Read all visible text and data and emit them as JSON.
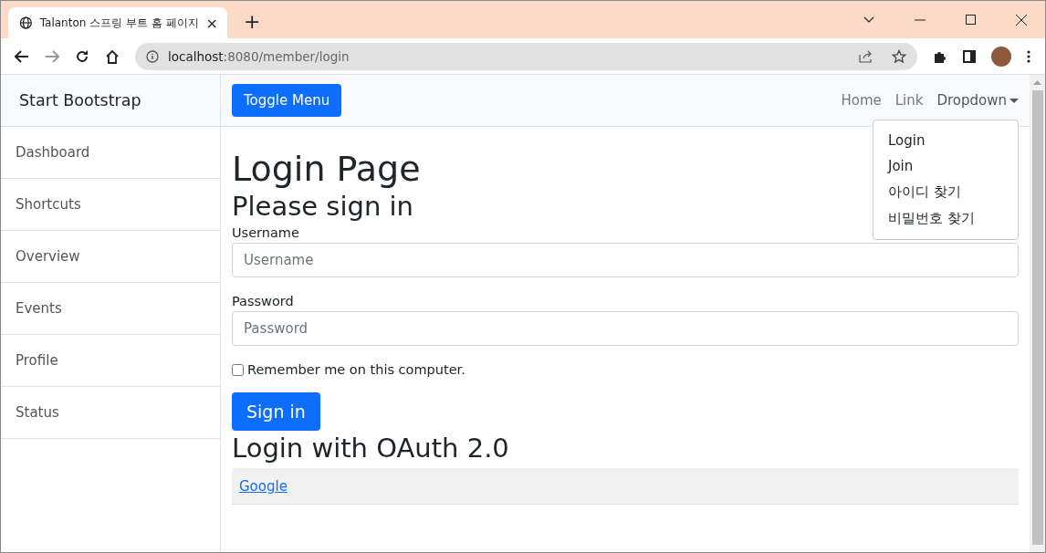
{
  "browser": {
    "tab_title": "Talanton 스프링 부트 홈 페이지",
    "tab_close": "×",
    "new_tab": "+",
    "url_host": "localhost",
    "url_path": ":8080/member/login"
  },
  "sidebar": {
    "brand": "Start Bootstrap",
    "items": [
      {
        "label": "Dashboard"
      },
      {
        "label": "Shortcuts"
      },
      {
        "label": "Overview"
      },
      {
        "label": "Events"
      },
      {
        "label": "Profile"
      },
      {
        "label": "Status"
      }
    ]
  },
  "navbar": {
    "toggle_button": "Toggle Menu",
    "links": [
      {
        "label": "Home"
      },
      {
        "label": "Link"
      }
    ],
    "dropdown": {
      "label": "Dropdown",
      "expanded": true,
      "items": [
        {
          "label": "Login"
        },
        {
          "label": "Join"
        },
        {
          "label": "아이디 찾기"
        },
        {
          "label": "비밀번호 찾기"
        }
      ]
    }
  },
  "page": {
    "title": "Login Page",
    "subtitle": "Please sign in",
    "username_label": "Username",
    "username_placeholder": "Username",
    "password_label": "Password",
    "password_placeholder": "Password",
    "remember": {
      "label": "Remember me on this computer.",
      "checked": false
    },
    "submit": "Sign in",
    "oauth_title": "Login with OAuth 2.0",
    "oauth_links": [
      "Google"
    ]
  }
}
